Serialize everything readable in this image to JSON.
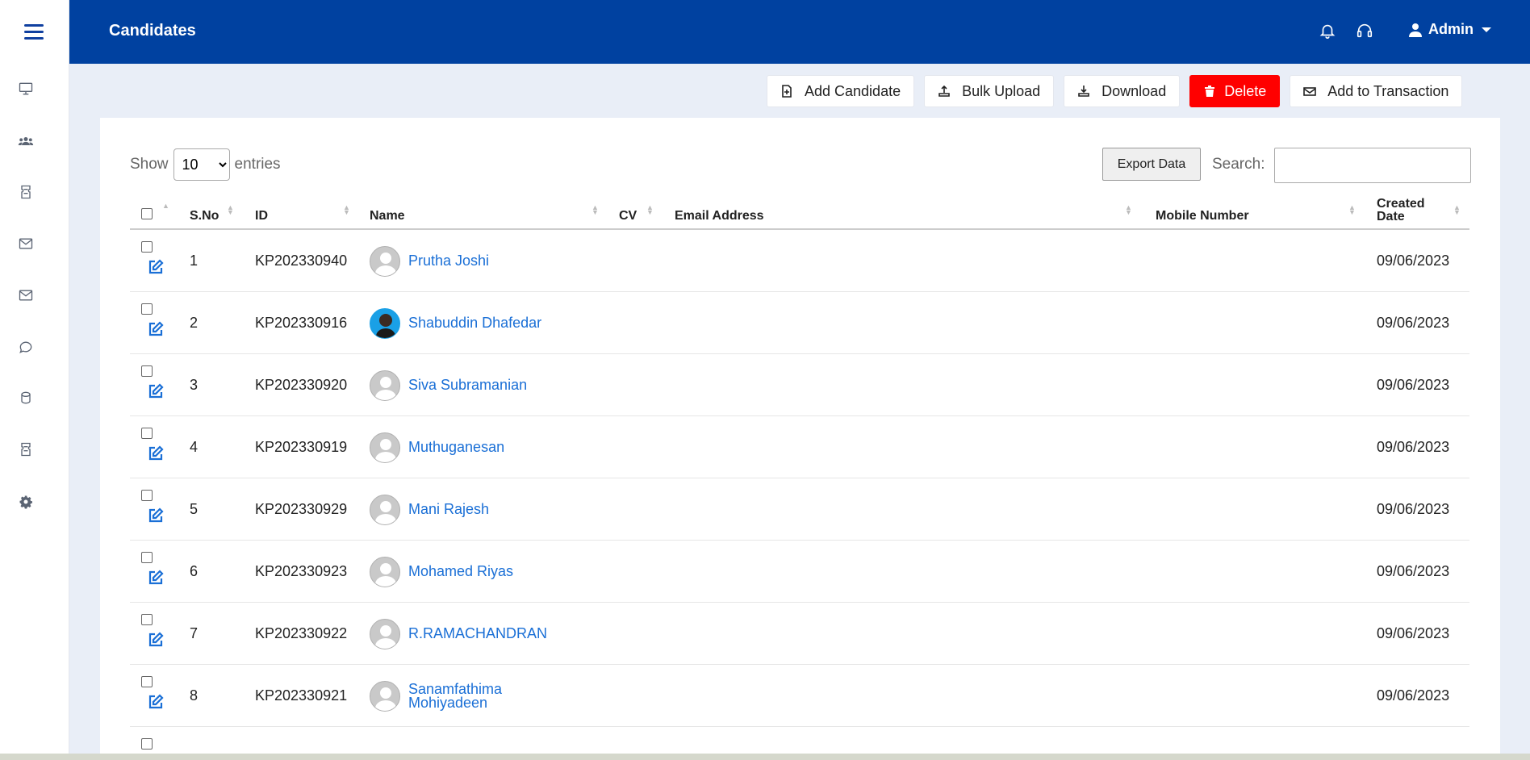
{
  "header": {
    "title": "Candidates",
    "user_label": "Admin"
  },
  "toolbar": {
    "add_candidate": "Add Candidate",
    "bulk_upload": "Bulk Upload",
    "download": "Download",
    "delete": "Delete",
    "add_to_transaction": "Add to Transaction"
  },
  "table_controls": {
    "show_label": "Show",
    "entries_value": "10",
    "entries_label": "entries",
    "export_label": "Export Data",
    "search_label": "Search:"
  },
  "columns": {
    "sno": "S.No",
    "id": "ID",
    "name": "Name",
    "cv": "CV",
    "email": "Email Address",
    "mobile": "Mobile Number",
    "created_line1": "Created",
    "created_line2": "Date"
  },
  "rows": [
    {
      "sno": "1",
      "id": "KP202330940",
      "name": "Prutha Joshi",
      "name2": "",
      "created": "09/06/2023",
      "photo": false
    },
    {
      "sno": "2",
      "id": "KP202330916",
      "name": "Shabuddin Dhafedar",
      "name2": "",
      "created": "09/06/2023",
      "photo": true
    },
    {
      "sno": "3",
      "id": "KP202330920",
      "name": "Siva Subramanian",
      "name2": "",
      "created": "09/06/2023",
      "photo": false
    },
    {
      "sno": "4",
      "id": "KP202330919",
      "name": "Muthuganesan",
      "name2": "",
      "created": "09/06/2023",
      "photo": false
    },
    {
      "sno": "5",
      "id": "KP202330929",
      "name": "Mani Rajesh",
      "name2": "",
      "created": "09/06/2023",
      "photo": false
    },
    {
      "sno": "6",
      "id": "KP202330923",
      "name": "Mohamed Riyas",
      "name2": "",
      "created": "09/06/2023",
      "photo": false
    },
    {
      "sno": "7",
      "id": "KP202330922",
      "name": "R.RAMACHANDRAN",
      "name2": "",
      "created": "09/06/2023",
      "photo": false
    },
    {
      "sno": "8",
      "id": "KP202330921",
      "name": "Sanamfathima",
      "name2": "Mohiyadeen",
      "created": "09/06/2023",
      "photo": false
    }
  ],
  "icons": {
    "sidebar": [
      "monitor-icon",
      "users-icon",
      "ticket-icon",
      "mail-icon",
      "mail-icon",
      "chat-icon",
      "database-icon",
      "ticket-icon",
      "gear-icon"
    ],
    "header": [
      "bell-icon",
      "headset-icon",
      "user-icon"
    ]
  },
  "colors": {
    "header_bg": "#0041a0",
    "link": "#1a6fd6",
    "delete": "#ff0000"
  }
}
